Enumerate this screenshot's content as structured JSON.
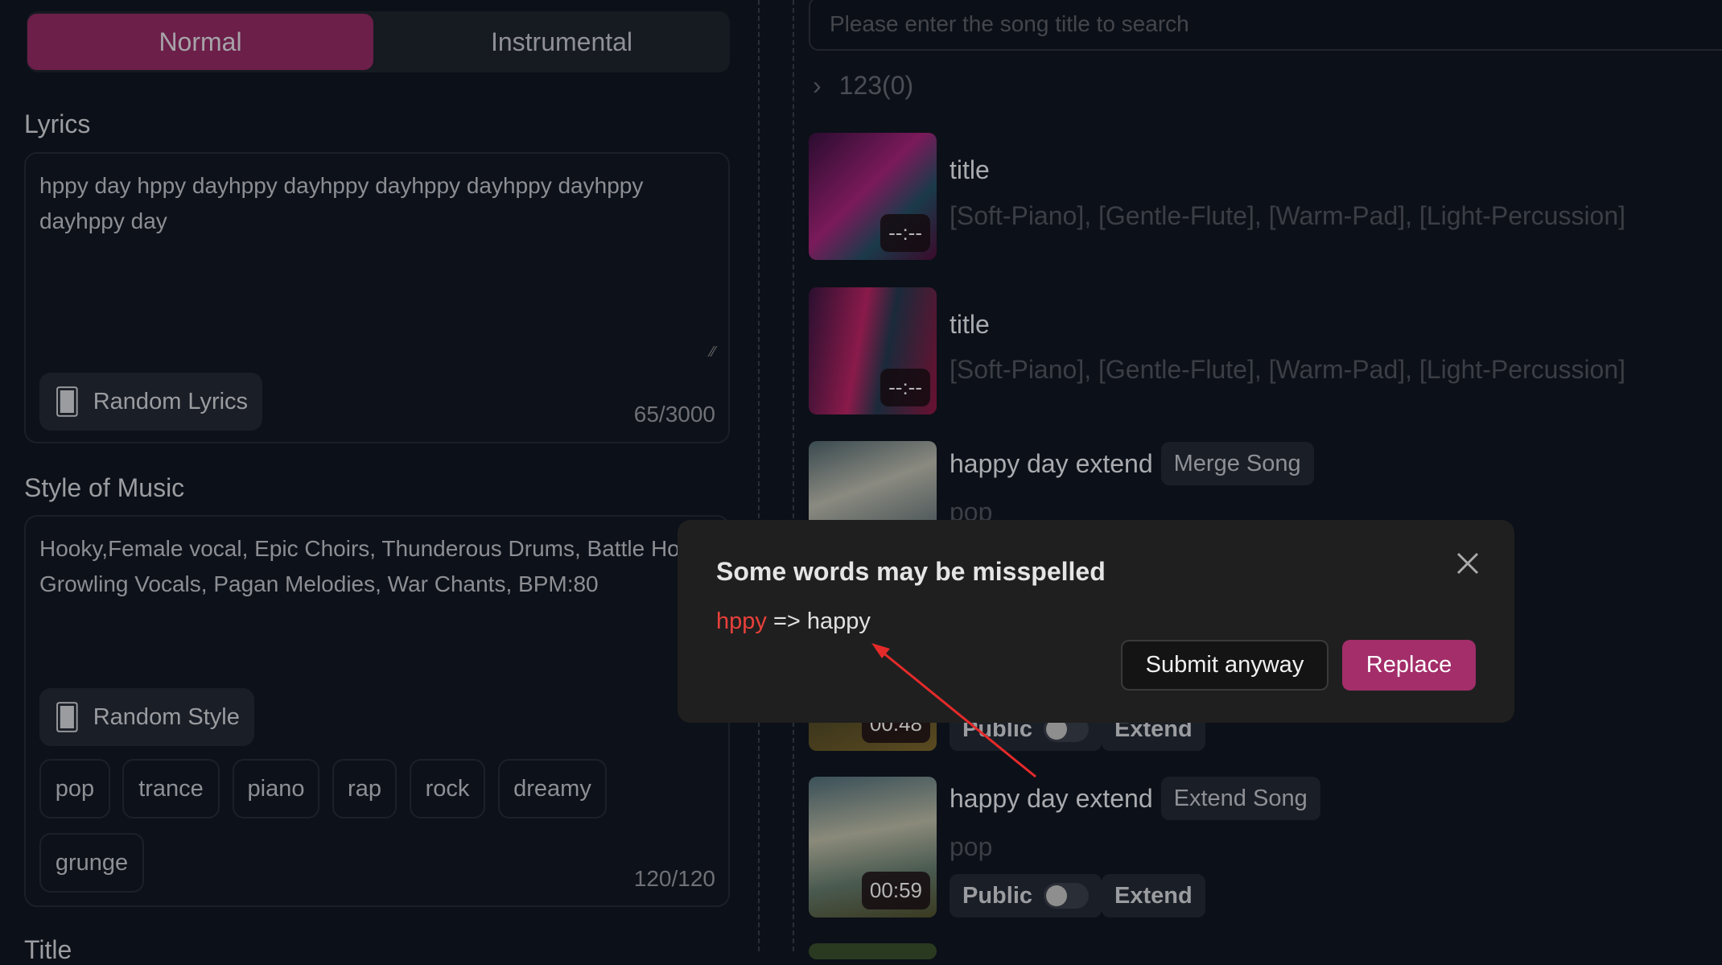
{
  "mode_toggle": {
    "options": [
      "Normal",
      "Instrumental"
    ],
    "selected": "Normal"
  },
  "lyrics": {
    "label": "Lyrics",
    "value": "hppy day hppy dayhppy dayhppy dayhppy dayhppy dayhppy dayhppy day",
    "random_button": "Random Lyrics",
    "count": "65/3000"
  },
  "style": {
    "label": "Style of Music",
    "value": "Hooky,Female vocal, Epic Choirs, Thunderous Drums, Battle Horns, Growling Vocals, Pagan Melodies, War Chants, BPM:80",
    "random_button": "Random Style",
    "tags": [
      "pop",
      "trance",
      "piano",
      "rap",
      "rock",
      "dreamy",
      "grunge"
    ],
    "count": "120/120"
  },
  "title_label": "Title",
  "search": {
    "placeholder": "Please enter the song title to search"
  },
  "folder": {
    "label": "123(0)"
  },
  "songs": [
    {
      "title": "title",
      "tags": "[Soft-Piano], [Gentle-Flute], [Warm-Pad], [Light-Percussion]",
      "duration": "--:--"
    },
    {
      "title": "title",
      "tags": "[Soft-Piano], [Gentle-Flute], [Warm-Pad], [Light-Percussion]",
      "duration": "--:--"
    },
    {
      "title": "happy day extend",
      "badge": "Merge Song",
      "tags": "pop"
    },
    {
      "duration": "00:48",
      "public_label": "Public",
      "extend_label": "Extend"
    },
    {
      "title": "happy day extend",
      "badge": "Extend Song",
      "tags": "pop",
      "duration": "00:59",
      "public_label": "Public",
      "extend_label": "Extend"
    }
  ],
  "modal": {
    "title": "Some words may be misspelled",
    "wrong": "hppy",
    "arrow": "=>",
    "correct": "happy",
    "submit_label": "Submit anyway",
    "replace_label": "Replace"
  },
  "colors": {
    "accent": "#a32e6a",
    "toggle_active": "#6b1f49",
    "misspelled": "#e8403a",
    "annotation_arrow": "#e52a2a"
  }
}
